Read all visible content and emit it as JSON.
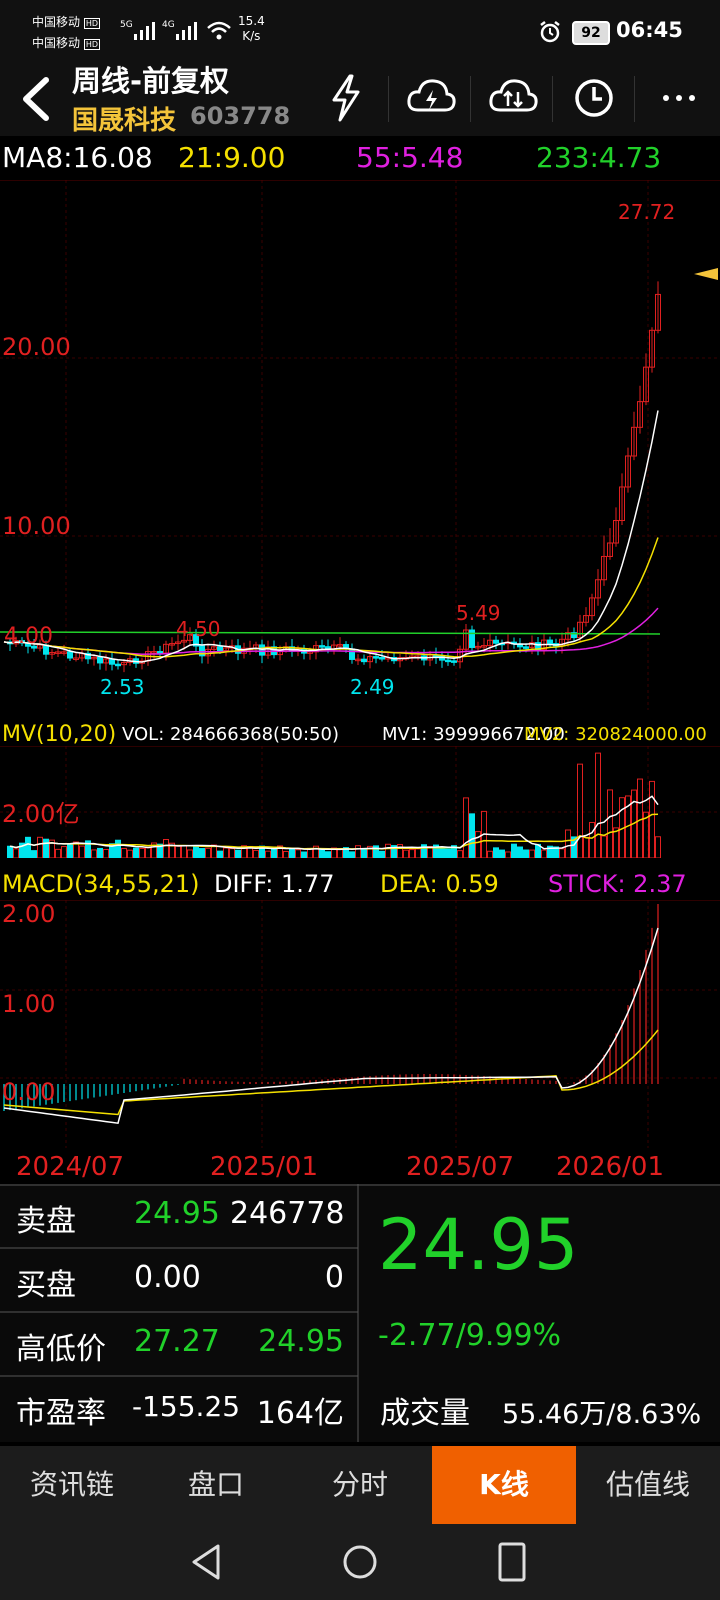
{
  "status": {
    "carrier1": "中国移动",
    "carrier2": "中国移动",
    "hd": "HD",
    "net1": "5G",
    "net2": "4G",
    "speed_value": "15.4",
    "speed_unit": "K/s",
    "battery": "92",
    "time": "06:45"
  },
  "header": {
    "title": "周线-前复权",
    "stock_name": "国晟科技",
    "stock_code": "603778"
  },
  "ma": {
    "ma8": "MA8:16.08",
    "ma21": "21:9.00",
    "ma55": "55:5.48",
    "ma233": "233:4.73"
  },
  "price_axis": {
    "label_20": "20.00",
    "label_10": "10.00",
    "label_4": "4.00",
    "ann_high": "27.72",
    "ann_450": "4.50",
    "ann_253": "2.53",
    "ann_249": "2.49",
    "ann_549": "5.49"
  },
  "volume": {
    "title": "MV(10,20)",
    "vol": "VOL: 284666368(50:50)",
    "mv1": "MV1: 399996672.00",
    "mv2": "MV2: 320824000.00",
    "axis_label": "2.00亿"
  },
  "macd": {
    "title": "MACD(34,55,21)",
    "diff": "DIFF: 1.77",
    "dea": "DEA: 0.59",
    "stick": "STICK: 2.37",
    "label_2": "2.00",
    "label_1": "1.00",
    "label_0": "0.00"
  },
  "dates": [
    "2024/07",
    "2025/01",
    "2025/07",
    "2026/01"
  ],
  "quote": {
    "sell_label": "卖盘",
    "sell_price": "24.95",
    "sell_vol": "246778",
    "buy_label": "买盘",
    "buy_price": "0.00",
    "buy_vol": "0",
    "hl_label": "高低价",
    "high": "27.27",
    "low": "24.95",
    "pe_label": "市盈率",
    "pe": "-155.25",
    "mktcap": "164亿",
    "price": "24.95",
    "change": "-2.77/9.99%",
    "turnover_label": "成交量",
    "turnover": "55.46万/8.63%"
  },
  "tabs": [
    "资讯链",
    "盘口",
    "分时",
    "K线",
    "估值线"
  ],
  "active_tab": "K线",
  "colors": {
    "up": "#e02020",
    "down": "#00e5ee",
    "green": "#21d12a",
    "yellow": "#f4e000",
    "magenta": "#e020e0",
    "accent": "#f06000"
  },
  "icons": [
    "back-arrow-icon",
    "lightning-icon",
    "cloud-lightning-icon",
    "cloud-sync-icon",
    "history-clock-icon",
    "more-icon"
  ]
}
